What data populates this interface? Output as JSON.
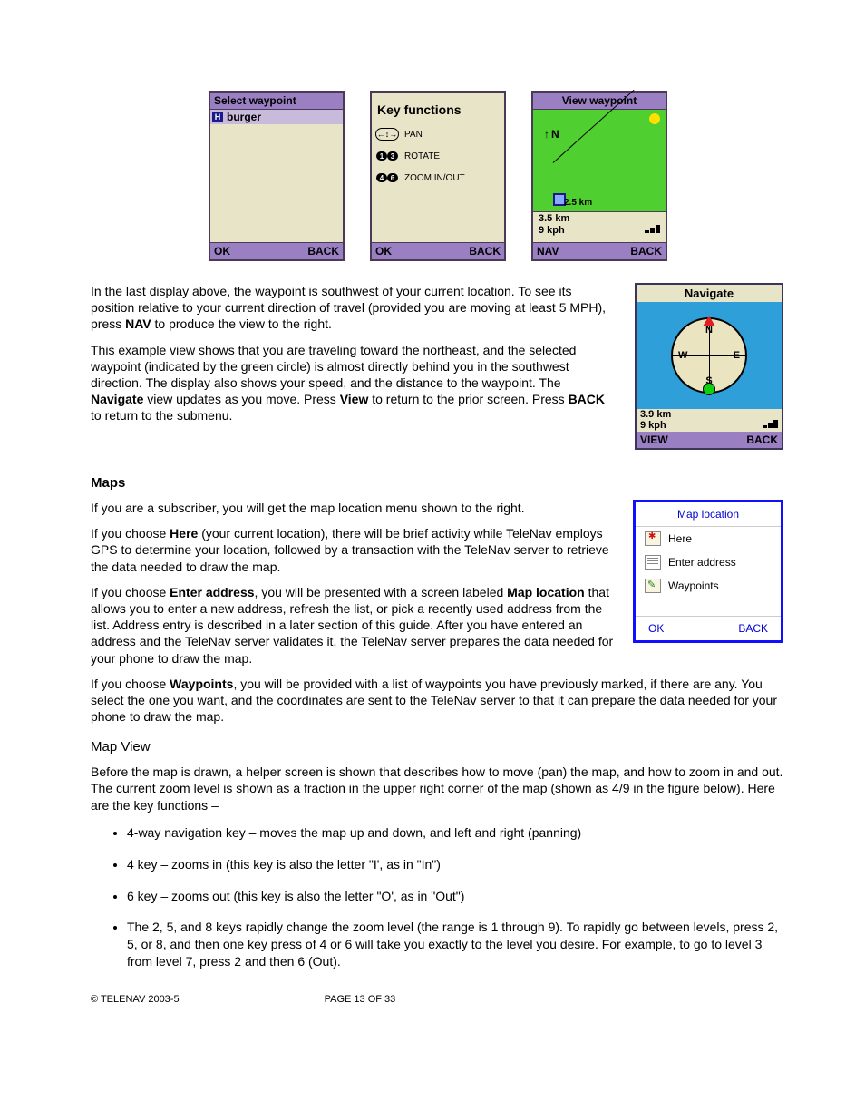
{
  "screen1": {
    "title": "Select waypoint",
    "item_icon": "H",
    "item_label": "burger",
    "left": "OK",
    "right": "BACK"
  },
  "screen2": {
    "title": "Key functions",
    "row1": "PAN",
    "row2": "ROTATE",
    "row3": "ZOOM IN/OUT",
    "key1a": "1",
    "key1b": "3",
    "key2a": "4",
    "key2b": "6",
    "left": "OK",
    "right": "BACK"
  },
  "screen3": {
    "title": "View waypoint",
    "north": "N",
    "ruler": "2.5 km",
    "dist": "3.5 km",
    "speed": "9 kph",
    "left": "NAV",
    "right": "BACK"
  },
  "navscreen": {
    "title": "Navigate",
    "N": "N",
    "E": "E",
    "S": "S",
    "W": "W",
    "dist": "3.9 km",
    "speed": "9 kph",
    "left": "VIEW",
    "right": "BACK"
  },
  "mlmenu": {
    "title": "Map location",
    "item1": "Here",
    "item2": "Enter address",
    "item3": "Waypoints",
    "left": "OK",
    "right": "BACK"
  },
  "body": {
    "p1a": "In the last display above, the waypoint is southwest of your current location.  To see its position relative to your current direction of travel (provided you are moving at least 5 MPH), press ",
    "p1b": "NAV",
    "p1c": " to produce the view to the right.",
    "p2a": "This example view shows that you are traveling toward the northeast, and the selected waypoint (indicated by the green circle) is almost directly behind you in the southwest direction.  The display also shows your speed, and the distance to the waypoint.  The ",
    "p2b": "Navigate",
    "p2c": " view updates as you move.  Press ",
    "p2d": "View",
    "p2e": " to return to the prior screen.  Press ",
    "p2f": "BACK",
    "p2g": " to return to the submenu.",
    "h_maps": "Maps",
    "p3": "If you are a subscriber, you will get the map location menu shown to the right.",
    "p4a": "If you choose ",
    "p4b": "Here",
    "p4c": " (your current location), there will be brief activity while TeleNav employs GPS to determine your location, followed by a transaction with the TeleNav server to retrieve the data needed to draw the map.",
    "p5a": "If you choose ",
    "p5b": "Enter address",
    "p5c": ", you will be presented with a screen labeled ",
    "p5d": "Map location",
    "p5e": " that allows you to enter a new address, refresh the list, or pick a recently used address from the list.  Address entry is described in a later section of this guide.  After you have entered an address and the TeleNav server validates it, the TeleNav server prepares the data needed for your phone to draw the map.",
    "p6a": "If you choose ",
    "p6b": "Waypoints",
    "p6c": ", you will be provided with a list of waypoints you have previously marked, if there are any.  You select the one you want, and the coordinates are sent to the TeleNav server to that it can prepare the data needed for your phone to draw the map.",
    "h_mapview": "Map View",
    "p7": "Before the map is drawn, a helper screen is shown that describes how to move (pan) the map, and how to zoom in and out.  The current zoom level is shown as a fraction in the upper right corner of the map (shown as 4/9 in the figure below).  Here are the key functions –",
    "li1": "4-way navigation key – moves the map up and down, and left and right (panning)",
    "li2": "4 key – zooms in (this key is also the letter \"I', as in \"In\")",
    "li3": "6 key – zooms out (this key is also the letter \"O', as in \"Out\")",
    "li4": "The 2, 5, and 8 keys rapidly change the zoom level (the range is 1 through 9).    To rapidly go between levels, press 2, 5, or 8, and then one key press of 4 or 6 will take you exactly to the level you desire.  For example, to go to level 3 from level 7, press 2 and then 6 (Out)."
  },
  "footer": {
    "copyright": "© TELENAV 2003-5",
    "page": "PAGE 13 OF 33"
  }
}
